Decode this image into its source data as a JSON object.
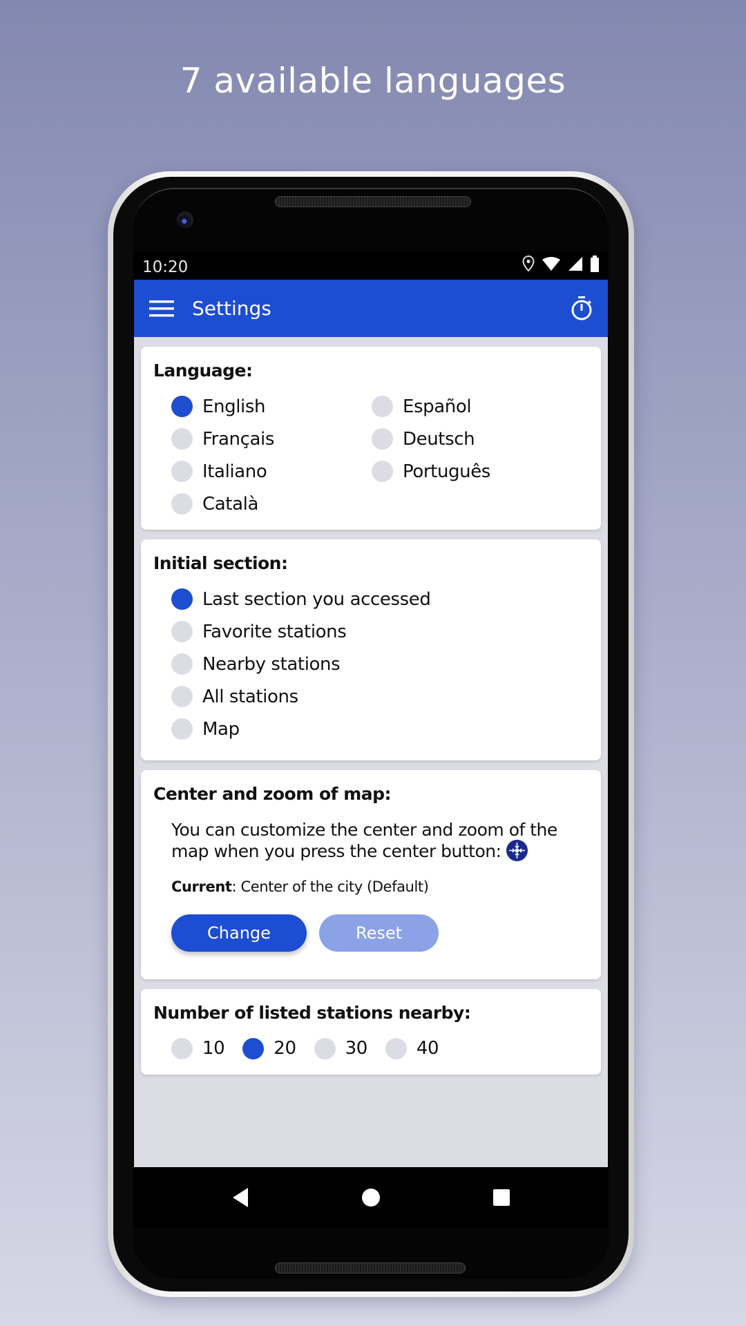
{
  "headline": "7 available languages",
  "statusbar": {
    "time": "10:20",
    "icons": [
      "location-icon",
      "wifi-icon",
      "signal-icon",
      "battery-icon"
    ]
  },
  "appbar": {
    "title": "Settings",
    "menu_icon": "hamburger-menu-icon",
    "action_icon": "stopwatch-icon"
  },
  "language": {
    "title": "Language:",
    "options": [
      {
        "label": "English",
        "selected": true
      },
      {
        "label": "Español",
        "selected": false
      },
      {
        "label": "Français",
        "selected": false
      },
      {
        "label": "Deutsch",
        "selected": false
      },
      {
        "label": "Italiano",
        "selected": false
      },
      {
        "label": "Português",
        "selected": false
      },
      {
        "label": "Català",
        "selected": false
      }
    ]
  },
  "initial_section": {
    "title": "Initial section:",
    "options": [
      {
        "label": "Last section you accessed",
        "selected": true
      },
      {
        "label": "Favorite stations",
        "selected": false
      },
      {
        "label": "Nearby stations",
        "selected": false
      },
      {
        "label": "All stations",
        "selected": false
      },
      {
        "label": "Map",
        "selected": false
      }
    ]
  },
  "map_center": {
    "title": "Center and zoom of map:",
    "description": "You can customize the center and zoom of the map when you press the center button:",
    "current_label": "Current",
    "current_value": ": Center of the city (Default)",
    "change_label": "Change",
    "reset_label": "Reset"
  },
  "nearby_count": {
    "title": "Number of listed stations nearby:",
    "options": [
      {
        "label": "10",
        "selected": false
      },
      {
        "label": "20",
        "selected": true
      },
      {
        "label": "30",
        "selected": false
      },
      {
        "label": "40",
        "selected": false
      }
    ]
  },
  "navbar": {
    "buttons": [
      "back-icon",
      "home-icon",
      "recents-icon"
    ]
  },
  "colors": {
    "accent": "#1d4dd0",
    "radio_off": "#dcdde4",
    "disabled_button": "#8ba3e6",
    "center_icon": "#1a2a8a"
  }
}
